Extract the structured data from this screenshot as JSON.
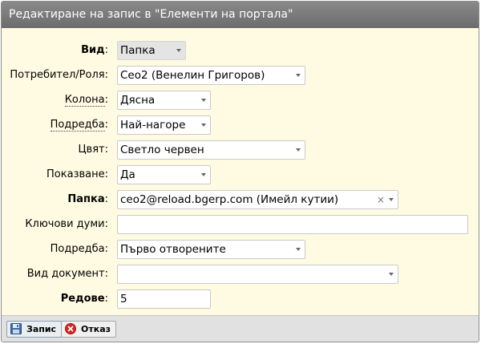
{
  "dialog": {
    "title": "Редактиране на запис в \"Елементи на портала\""
  },
  "fields": {
    "vid": {
      "label": "Вид",
      "value": "Папка"
    },
    "user_role": {
      "label": "Потребител/Роля",
      "value": "Ceo2 (Венелин Григоров)"
    },
    "column": {
      "label": "Колона",
      "value": "Дясна"
    },
    "order": {
      "label": "Подредба",
      "value": "Най-нагоре"
    },
    "color": {
      "label": "Цвят",
      "value": "Светло червен"
    },
    "show": {
      "label": "Показване",
      "value": "Да"
    },
    "folder": {
      "label": "Папка",
      "value": "ceo2@reload.bgerp.com (Имейл кутии)",
      "clear": "×"
    },
    "keywords": {
      "label": "Ключови думи",
      "value": ""
    },
    "sort": {
      "label": "Подредба",
      "value": "Първо отворените"
    },
    "doc_type": {
      "label": "Вид документ",
      "value": ""
    },
    "rows": {
      "label": "Редове",
      "value": "5"
    }
  },
  "colon": ":",
  "toolbar": {
    "save_label": "Запис",
    "cancel_label": "Отказ"
  },
  "colors": {
    "title_bg": "#7b7b7b",
    "form_bg": "#fffbe2",
    "toolbar_bg": "#e1e1e1"
  }
}
